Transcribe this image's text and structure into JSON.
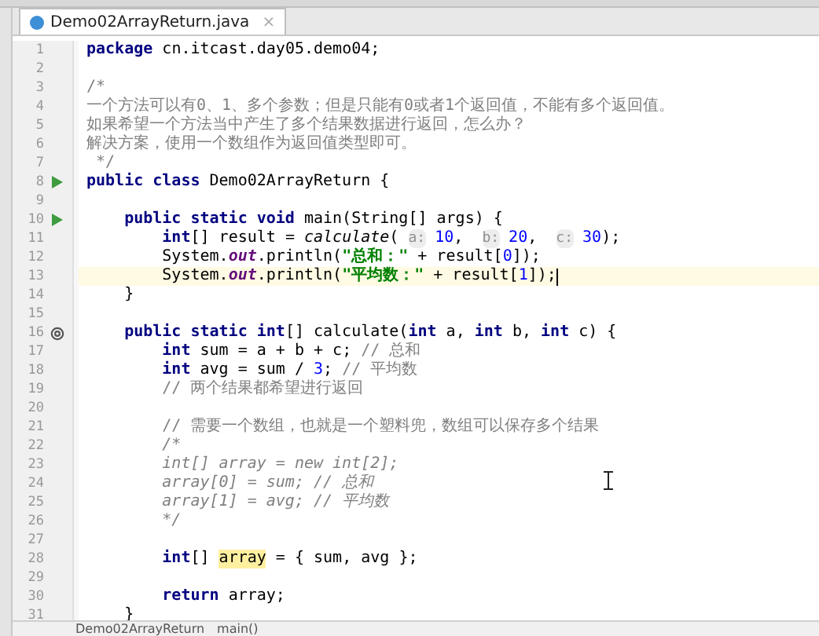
{
  "tab": {
    "title": "Demo02ArrayReturn.java",
    "close": "×",
    "selected": true
  },
  "lines": [
    {
      "number": "1",
      "current": false,
      "tokens": [
        {
          "kind": "kw",
          "text": "package"
        },
        {
          "kind": "plain",
          "text": " cn.itcast.day05.demo04;"
        }
      ]
    },
    {
      "number": "2",
      "current": false
    },
    {
      "number": "3",
      "current": false,
      "tokens": [
        {
          "kind": "comment",
          "text": "/*"
        }
      ]
    },
    {
      "number": "4",
      "current": false,
      "tokens": [
        {
          "kind": "comment",
          "text": "一个方法可以有0、1、多个参数；但是只能有0或者1个返回值，不能有多个返回值。"
        }
      ]
    },
    {
      "number": "5",
      "current": false,
      "tokens": [
        {
          "kind": "comment",
          "text": "如果希望一个方法当中产生了多个结果数据进行返回，怎么办？"
        }
      ]
    },
    {
      "number": "6",
      "current": false,
      "tokens": [
        {
          "kind": "comment",
          "text": "解决方案，使用一个数组作为返回值类型即可。"
        }
      ]
    },
    {
      "number": "7",
      "current": false,
      "tokens": [
        {
          "kind": "comment",
          "text": " */"
        }
      ]
    },
    {
      "number": "8",
      "gutter": {
        "kind": "run"
      },
      "current": false,
      "tokens": [
        {
          "kind": "kw",
          "text": "public class"
        },
        {
          "kind": "plain",
          "text": " Demo02ArrayReturn {"
        }
      ]
    },
    {
      "number": "9",
      "current": false
    },
    {
      "number": "10",
      "gutter": {
        "kind": "run"
      },
      "current": false,
      "tokens": [
        {
          "kind": "kw",
          "text": "    public static void"
        },
        {
          "kind": "plain",
          "text": " main(String[] args) {"
        }
      ]
    },
    {
      "number": "11",
      "current": false,
      "tokens": [
        {
          "kind": "kw",
          "text": "        int"
        },
        {
          "kind": "plain",
          "text": "[] result = "
        },
        {
          "kind": "call",
          "text": "calculate"
        },
        {
          "kind": "plain",
          "text": "( "
        },
        {
          "kind": "hint",
          "text": "a:"
        },
        {
          "kind": "num",
          "text": " 10"
        },
        {
          "kind": "plain",
          "text": ",  "
        },
        {
          "kind": "hint",
          "text": "b:"
        },
        {
          "kind": "num",
          "text": " 20"
        },
        {
          "kind": "plain",
          "text": ",  "
        },
        {
          "kind": "hint",
          "text": "c:"
        },
        {
          "kind": "num",
          "text": " 30"
        },
        {
          "kind": "plain",
          "text": ");"
        }
      ]
    },
    {
      "number": "12",
      "current": false,
      "tokens": [
        {
          "kind": "plain",
          "text": "        System."
        },
        {
          "kind": "field",
          "text": "out"
        },
        {
          "kind": "plain",
          "text": ".println("
        },
        {
          "kind": "str",
          "text": "\"总和：\""
        },
        {
          "kind": "plain",
          "text": " + result["
        },
        {
          "kind": "num",
          "text": "0"
        },
        {
          "kind": "plain",
          "text": "]);"
        }
      ]
    },
    {
      "number": "13",
      "current": true,
      "tokens": [
        {
          "kind": "plain",
          "text": "        System."
        },
        {
          "kind": "field",
          "text": "out"
        },
        {
          "kind": "plain",
          "text": ".println("
        },
        {
          "kind": "str",
          "text": "\"平均数：\""
        },
        {
          "kind": "plain",
          "text": " + result["
        },
        {
          "kind": "num",
          "text": "1"
        },
        {
          "kind": "plain",
          "text": "]);"
        }
      ]
    },
    {
      "number": "14",
      "current": false,
      "tokens": [
        {
          "kind": "plain",
          "text": "    }"
        }
      ]
    },
    {
      "number": "15",
      "current": false
    },
    {
      "number": "16",
      "gutter": {
        "kind": "override"
      },
      "current": false,
      "tokens": [
        {
          "kind": "kw",
          "text": "    public static int"
        },
        {
          "kind": "plain",
          "text": "[] calculate("
        },
        {
          "kind": "kw",
          "text": "int"
        },
        {
          "kind": "plain",
          "text": " a, "
        },
        {
          "kind": "kw",
          "text": "int"
        },
        {
          "kind": "plain",
          "text": " b, "
        },
        {
          "kind": "kw",
          "text": "int"
        },
        {
          "kind": "plain",
          "text": " c) {"
        }
      ]
    },
    {
      "number": "17",
      "current": false,
      "tokens": [
        {
          "kind": "kw",
          "text": "        int"
        },
        {
          "kind": "plain",
          "text": " sum = a + b + c; "
        },
        {
          "kind": "comment",
          "text": "// 总和"
        }
      ]
    },
    {
      "number": "18",
      "current": false,
      "tokens": [
        {
          "kind": "kw",
          "text": "        int"
        },
        {
          "kind": "plain",
          "text": " avg = sum / "
        },
        {
          "kind": "num",
          "text": "3"
        },
        {
          "kind": "plain",
          "text": "; "
        },
        {
          "kind": "comment",
          "text": "// 平均数"
        }
      ]
    },
    {
      "number": "19",
      "current": false,
      "tokens": [
        {
          "kind": "comment",
          "text": "        // 两个结果都希望进行返回"
        }
      ]
    },
    {
      "number": "20",
      "current": false
    },
    {
      "number": "21",
      "current": false,
      "tokens": [
        {
          "kind": "comment",
          "text": "        // 需要一个数组，也就是一个塑料兜，数组可以保存多个结果"
        }
      ]
    },
    {
      "number": "22",
      "current": false,
      "tokens": [
        {
          "kind": "dead",
          "text": "        /*"
        }
      ]
    },
    {
      "number": "23",
      "current": false,
      "tokens": [
        {
          "kind": "dead",
          "text": "        int[] array = new int[2];"
        }
      ]
    },
    {
      "number": "24",
      "current": false,
      "tokens": [
        {
          "kind": "dead",
          "text": "        array[0] = sum; // 总和"
        }
      ]
    },
    {
      "number": "25",
      "current": false,
      "tokens": [
        {
          "kind": "dead",
          "text": "        array[1] = avg; // 平均数"
        }
      ]
    },
    {
      "number": "26",
      "current": false,
      "tokens": [
        {
          "kind": "dead",
          "text": "        */"
        }
      ]
    },
    {
      "number": "27",
      "current": false
    },
    {
      "number": "28",
      "current": false,
      "tokens": [
        {
          "kind": "kw",
          "text": "        int"
        },
        {
          "kind": "plain",
          "text": "[] "
        },
        {
          "kind": "usage",
          "text": "array"
        },
        {
          "kind": "plain",
          "text": " = { sum, avg };"
        }
      ]
    },
    {
      "number": "29",
      "current": false
    },
    {
      "number": "30",
      "current": false,
      "tokens": [
        {
          "kind": "kw",
          "text": "        return"
        },
        {
          "kind": "plain",
          "text": " array;"
        }
      ]
    },
    {
      "number": "31",
      "current": false,
      "tokens": [
        {
          "kind": "plain",
          "text": "    }"
        }
      ]
    }
  ],
  "breadcrumb": [
    "Demo02ArrayReturn",
    "main()"
  ]
}
